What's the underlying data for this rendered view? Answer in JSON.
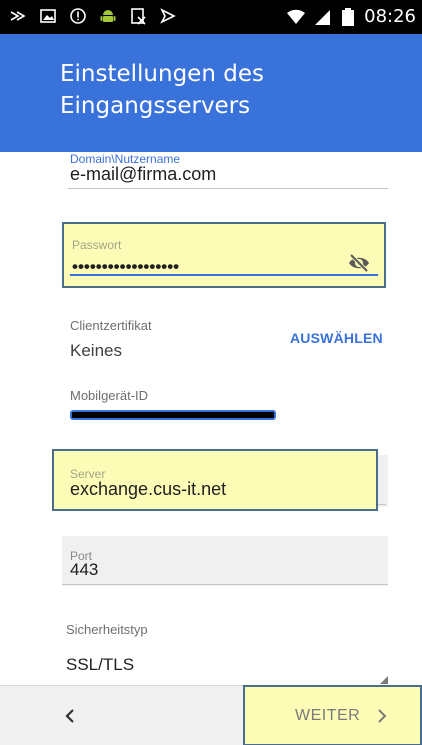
{
  "status_bar": {
    "time": "08:26",
    "icons": [
      "cast-icon",
      "image-icon",
      "alert-circle-icon",
      "android-icon",
      "screenshot-icon",
      "flag-icon",
      "wifi-icon",
      "signal-icon",
      "battery-icon"
    ]
  },
  "header": {
    "title_line1": "Einstellungen des",
    "title_line2": "Eingangsservers",
    "color": "#3a72db"
  },
  "form": {
    "domain": {
      "label": "Domain\\Nutzername",
      "value": "e-mail@firma.com"
    },
    "password": {
      "label": "Passwort",
      "value": "••••••••••••••••••"
    },
    "certificate": {
      "label": "Clientzertifikat",
      "value": "Keines",
      "action": "AUSWÄHLEN"
    },
    "device_id": {
      "label": "Mobilgerät-ID"
    },
    "server": {
      "label": "Server",
      "value": "exchange.cus-it.net"
    },
    "port": {
      "label": "Port",
      "value": "443"
    },
    "security": {
      "label": "Sicherheitstyp",
      "value": "SSL/TLS"
    }
  },
  "bottom_bar": {
    "next_label": "WEITER"
  },
  "highlight_color": "#fcfcb6"
}
